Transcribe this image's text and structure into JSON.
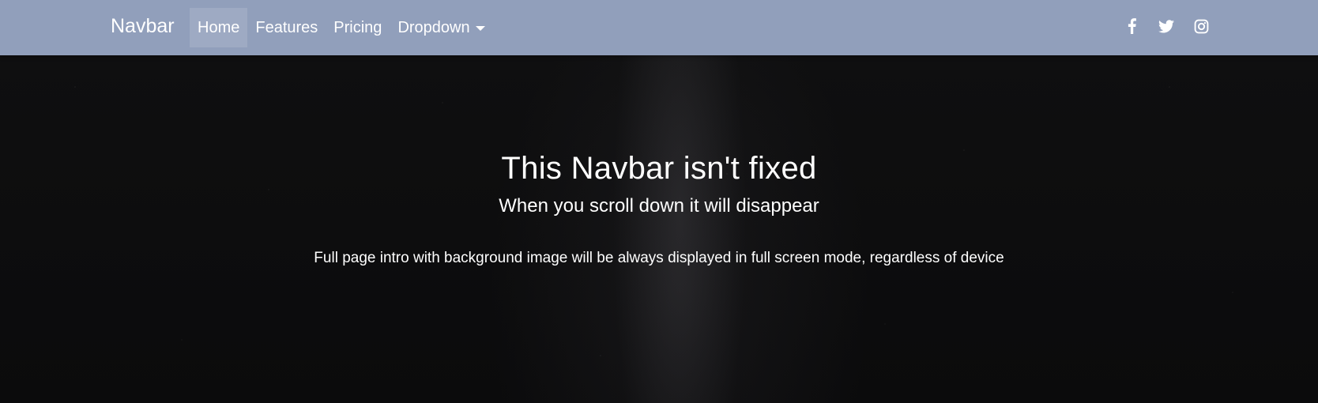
{
  "navbar": {
    "brand": "Navbar",
    "links": [
      {
        "label": "Home",
        "active": true
      },
      {
        "label": "Features"
      },
      {
        "label": "Pricing"
      },
      {
        "label": "Dropdown"
      }
    ],
    "social": [
      "facebook-icon",
      "twitter-icon",
      "instagram-icon"
    ],
    "background_color": "#919fbb"
  },
  "hero": {
    "title": "This Navbar isn't fixed",
    "subtitle": "When you scroll down it will disappear",
    "description": "Full page intro with background image will be always displayed in full screen mode, regardless of device"
  }
}
